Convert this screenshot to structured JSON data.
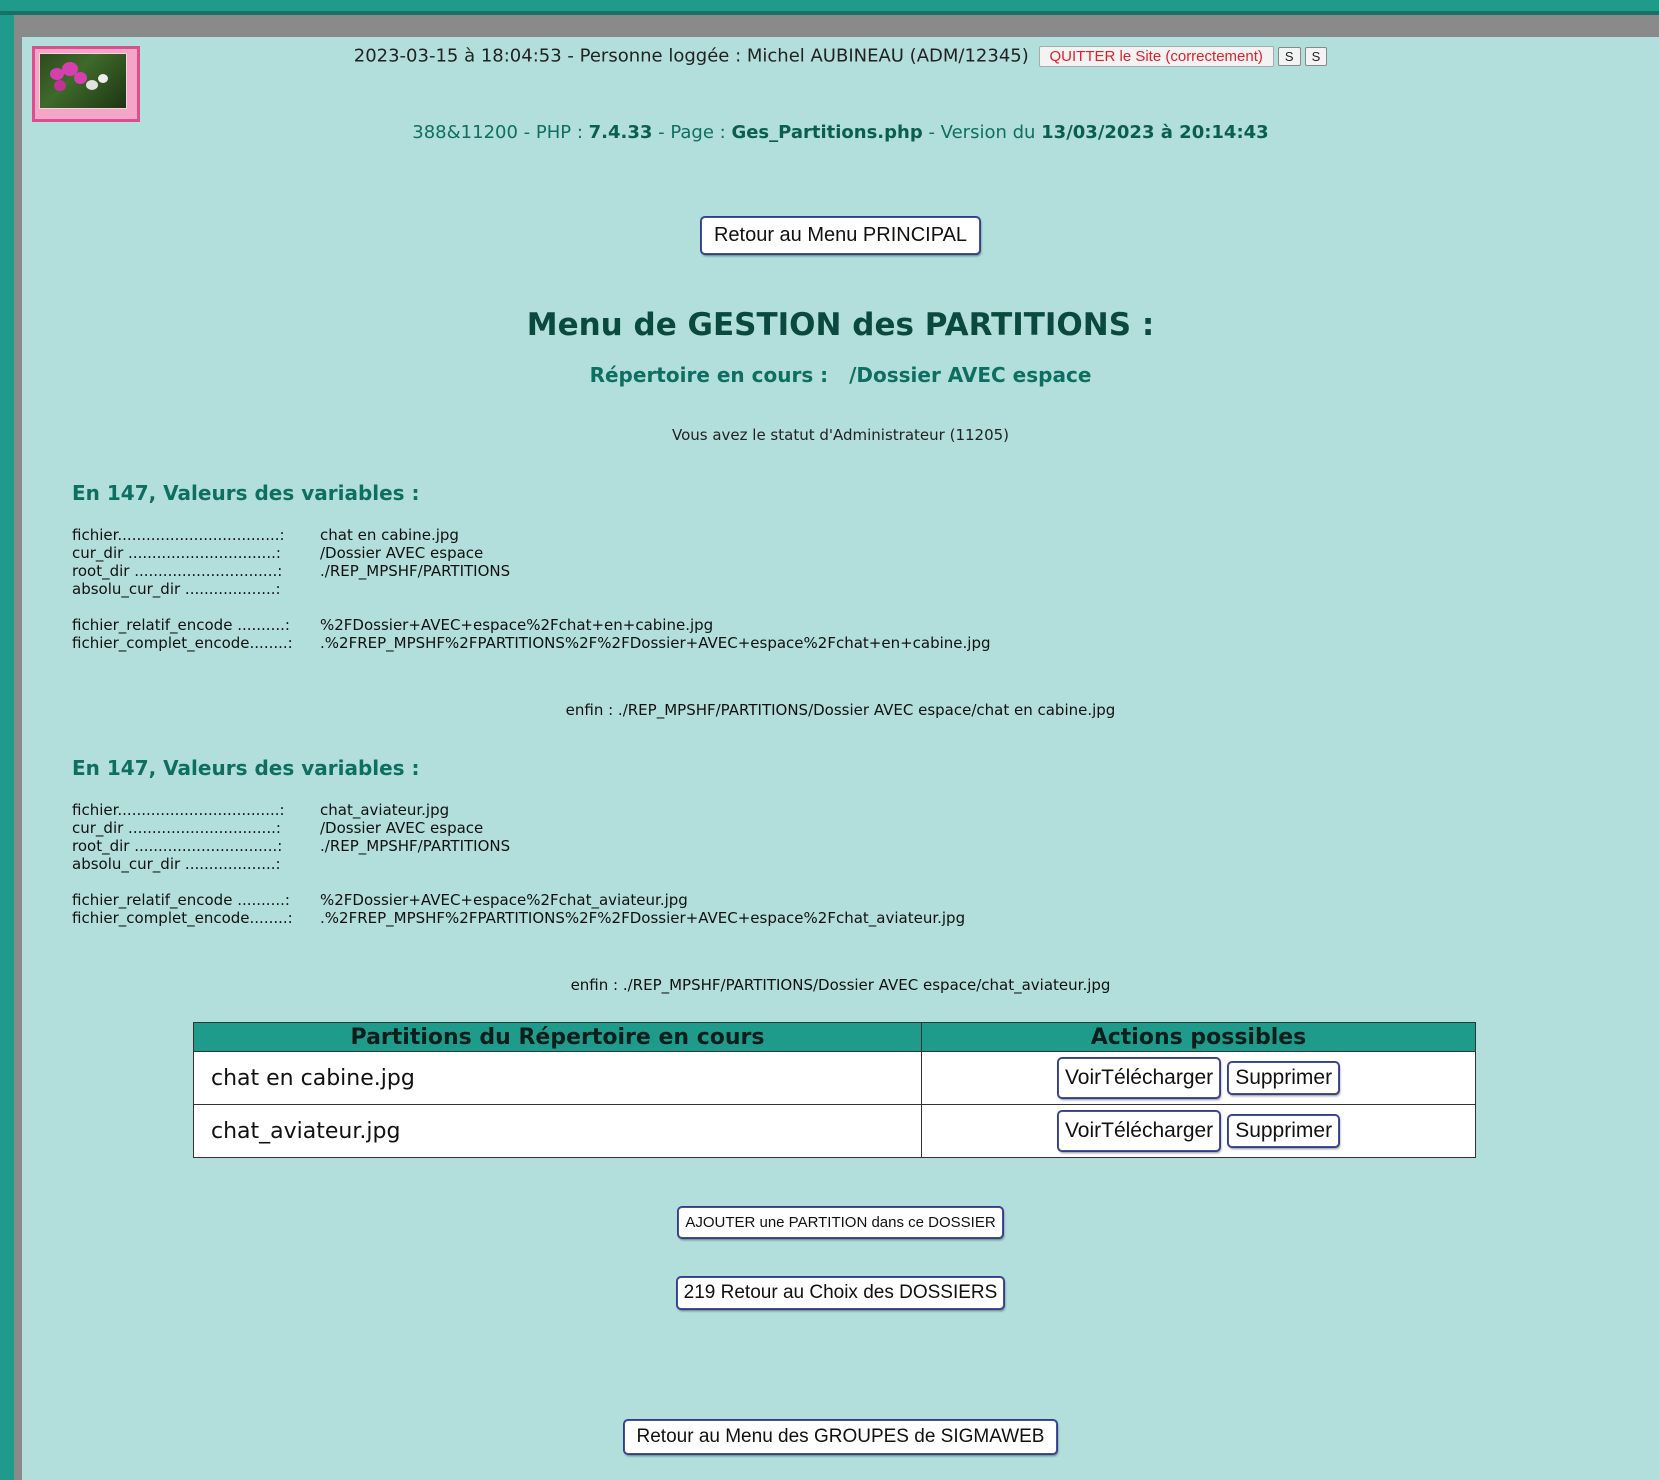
{
  "header": {
    "datetime": "2023-03-15 à 18:04:53",
    "sep1": " - ",
    "user_label": "Personne loggée : ",
    "user_name": "Michel AUBINEAU (ADM/12345)",
    "quit_label": "QUITTER le Site (correctement)",
    "s1_label": "S",
    "s2_label": "S"
  },
  "info": {
    "ids": "388&11200 - PHP : ",
    "php_version": "7.4.33",
    "page_label": " - Page : ",
    "page_name": "Ges_Partitions.php",
    "version_label": " - Version du ",
    "version_date": "13/03/2023 à 20:14:43"
  },
  "buttons": {
    "retour_principal": "Retour au Menu PRINCIPAL",
    "ajouter": "AJOUTER une PARTITION dans ce DOSSIER",
    "retour_dossiers": "219 Retour au Choix des DOSSIERS",
    "retour_groupes": "Retour au Menu des GROUPES de SIGMAWEB"
  },
  "title": "Menu de GESTION des PARTITIONS :",
  "subtitle": {
    "label": "Répertoire en cours :",
    "value": "/Dossier AVEC espace"
  },
  "statut": "Vous avez le statut d'Administrateur (11205)",
  "debug_blocks": [
    {
      "heading": "En 147, Valeurs des variables :",
      "rows": [
        {
          "k": "fichier..................................:",
          "v": " chat en cabine.jpg"
        },
        {
          "k": "cur_dir ...............................:",
          "v": "/Dossier AVEC espace"
        },
        {
          "k": "root_dir ..............................:",
          "v": " ./REP_MPSHF/PARTITIONS"
        },
        {
          "k": "absolu_cur_dir ...................:",
          "v": ""
        }
      ],
      "rows2": [
        {
          "k": "fichier_relatif_encode ..........:",
          "v": "%2FDossier+AVEC+espace%2Fchat+en+cabine.jpg"
        },
        {
          "k": "fichier_complet_encode........:",
          "v": ".%2FREP_MPSHF%2FPARTITIONS%2F%2FDossier+AVEC+espace%2Fchat+en+cabine.jpg"
        }
      ],
      "enfin": "enfin : ./REP_MPSHF/PARTITIONS/Dossier AVEC espace/chat en cabine.jpg"
    },
    {
      "heading": "En 147, Valeurs des variables :",
      "rows": [
        {
          "k": "fichier..................................:",
          "v": " chat_aviateur.jpg"
        },
        {
          "k": "cur_dir ...............................:",
          "v": "/Dossier AVEC espace"
        },
        {
          "k": "root_dir ..............................:",
          "v": " ./REP_MPSHF/PARTITIONS"
        },
        {
          "k": "absolu_cur_dir ...................:",
          "v": ""
        }
      ],
      "rows2": [
        {
          "k": "fichier_relatif_encode ..........:",
          "v": "%2FDossier+AVEC+espace%2Fchat_aviateur.jpg"
        },
        {
          "k": "fichier_complet_encode........:",
          "v": ".%2FREP_MPSHF%2FPARTITIONS%2F%2FDossier+AVEC+espace%2Fchat_aviateur.jpg"
        }
      ],
      "enfin": "enfin : ./REP_MPSHF/PARTITIONS/Dossier AVEC espace/chat_aviateur.jpg"
    }
  ],
  "table": {
    "headers": [
      "Partitions du Répertoire en cours",
      "Actions possibles"
    ],
    "rows": [
      {
        "name": "chat en cabine.jpg",
        "view": "VoirTélécharger",
        "delete": "Supprimer"
      },
      {
        "name": "chat_aviateur.jpg",
        "view": "VoirTélécharger",
        "delete": "Supprimer"
      }
    ]
  },
  "icons": {
    "logo": "orchid-photo-logo"
  },
  "colors": {
    "page_bg": "#b2dfdb",
    "frame": "#1f9b8c",
    "heading": "#0e6f60",
    "quit": "#e0202a"
  }
}
